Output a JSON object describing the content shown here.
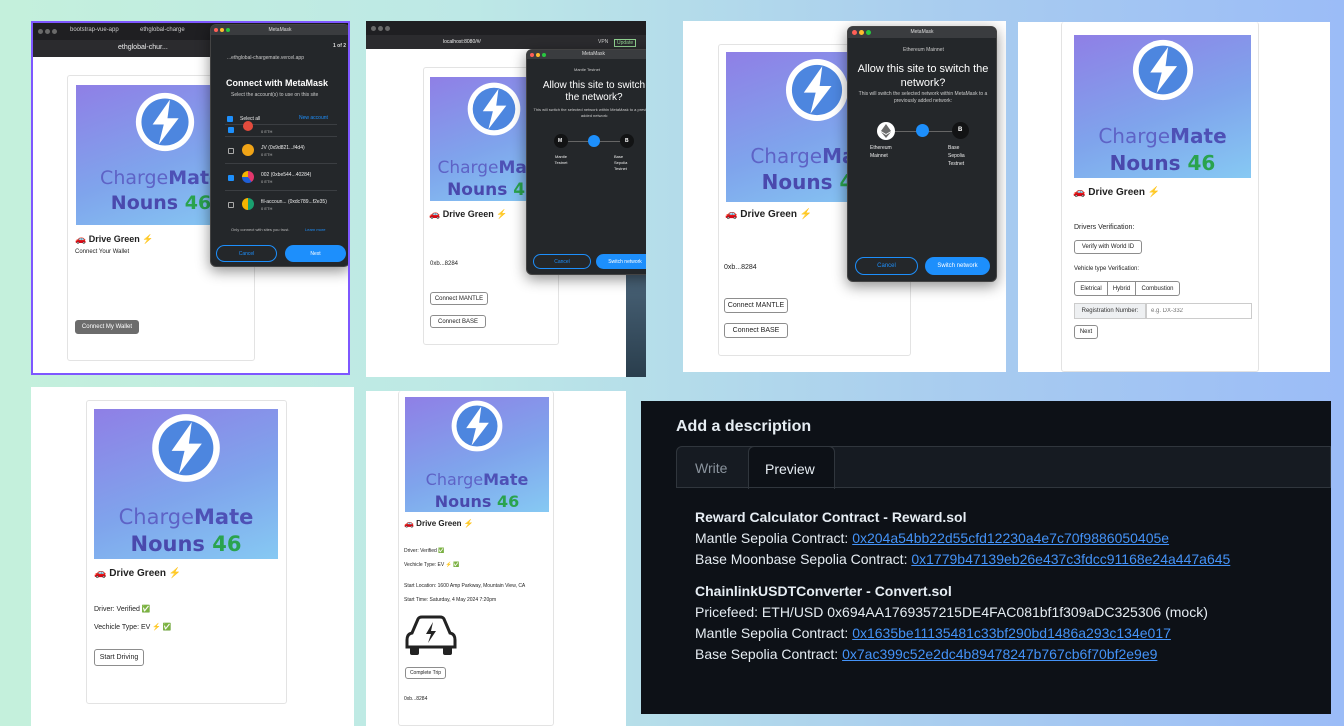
{
  "app": {
    "logo_top": "Charge",
    "logo_bold": "Mate",
    "nouns": "Nouns",
    "nouns_num": "46",
    "drive_green": "🚗 Drive Green ⚡"
  },
  "p1": {
    "tab1": "bootstrap-vue-app",
    "tab2": "ethglobal-charge",
    "tab3": "bootstr",
    "url": "ethglobal-chur...",
    "connect_wallet_label": "Connect Your Wallet",
    "connect_button": "Connect My Wallet",
    "mm_title": "MetaMask",
    "mm_site": "...ethglobal-chargemate.vercel.app",
    "mm_step": "1 of 2",
    "mm_heading": "Connect with MetaMask",
    "mm_sub": "Select the account(s) to use on this site",
    "select_all": "Select all",
    "new_account": "New account",
    "accounts": [
      {
        "name": "",
        "addr": "",
        "bal": "0 ETH"
      },
      {
        "name": "JV (0x9d821...f4d4)",
        "bal": "0 ETH"
      },
      {
        "name": "002 (0xbe544...40284)",
        "bal": "0 ETH"
      },
      {
        "name": "fil-accoun... (0xdc789...f2e35)",
        "bal": "0 ETH"
      }
    ],
    "trust_note": "Only connect with sites you trust.",
    "learn_more": "Learn more",
    "cancel": "Cancel",
    "next": "Next"
  },
  "p2": {
    "url": "localhost:8080/#/",
    "vpn": "VPN",
    "update": "Update",
    "mm_title": "MetaMask",
    "network": "Mantle Testnet",
    "heading": "Allow this site to switch the network?",
    "sub": "This will switch the selected network within MetaMask to a previously added network:",
    "from_letter": "M",
    "from_name": "Mantle Testnet",
    "to_letter": "B",
    "to_name": "Base Sepolia Testnet",
    "cancel": "Cancel",
    "switch": "Switch network",
    "address": "0xb...8284",
    "btn_mantle": "Connect MANTLE",
    "btn_base": "Connect   BASE"
  },
  "p3": {
    "mm_title": "MetaMask",
    "network": "Ethereum Mainnet",
    "heading": "Allow this site to switch the network?",
    "sub": "This will switch the selected network within MetaMask to a previously added network:",
    "from_name": "Ethereum Mainnet",
    "to_letter": "B",
    "to_name": "Base Sepolia Testnet",
    "cancel": "Cancel",
    "switch": "Switch network",
    "address": "0xb...8284",
    "btn_mantle": "Connect MANTLE",
    "btn_base": "Connect   BASE"
  },
  "p4": {
    "drivers_verification": "Drivers Verification:",
    "verify_button": "Verify with World ID",
    "vehicle_verification": "Vehicle type Verification:",
    "types": [
      "Eletrical",
      "Hybrid",
      "Combustion"
    ],
    "reg_label": "Registration Number:",
    "reg_placeholder": "e.g. DX-332",
    "next": "Next"
  },
  "p5": {
    "driver": "Driver: Verified ✅",
    "vehicle": "Vechicle Type: EV ⚡ ✅",
    "start": "Start Driving"
  },
  "p6": {
    "driver": "Driver: Verified ✅",
    "vehicle": "Vechicle Type: EV ⚡ ✅",
    "location": "Start Location: 1600 Amp Parkway, Mountain View, CA",
    "time": "Start Time: Saturday, 4 May 2024 7:20pm",
    "complete": "Complete Trip",
    "address": "0xb...8284"
  },
  "p7": {
    "title": "Add a description",
    "tab_write": "Write",
    "tab_preview": "Preview",
    "s1_title": "Reward Calculator Contract - Reward.sol",
    "s1_l1_label": "Mantle Sepolia Contract: ",
    "s1_l1_link": "0x204a54bb22d55cfd12230a4e7c70f9886050405e",
    "s1_l2_label": "Base Moonbase Sepolia Contract: ",
    "s1_l2_link": "0x1779b47139eb26e437c3fdcc91168e24a447a645",
    "s2_title": "ChainlinkUSDTConverter - Convert.sol",
    "s2_l1": "Pricefeed: ETH/USD 0x694AA1769357215DE4FAC081bf1f309aDC325306 (mock)",
    "s2_l2_label": "Mantle Sepolia Contract: ",
    "s2_l2_link": "0x1635be11135481c33bf290bd1486a293c134e017",
    "s2_l3_label": "Base Sepolia Contract: ",
    "s2_l3_link": "0x7ac399c52e2dc4b89478247b767cb6f70bf2e9e9"
  },
  "colors": {
    "accent": "#1d8ffc",
    "gh_bg": "#0d1117",
    "gh_link": "#4493f8",
    "purple_border": "#7e57ff"
  }
}
